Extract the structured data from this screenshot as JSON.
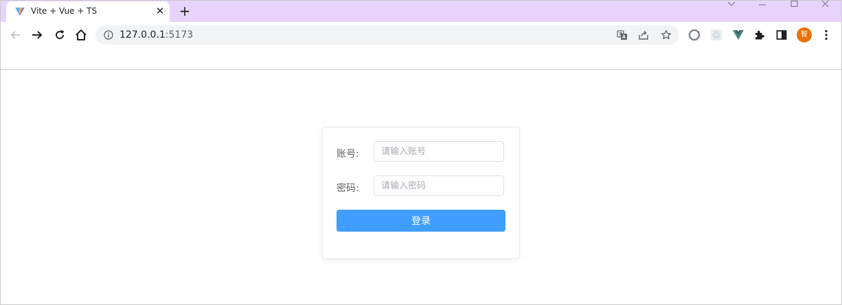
{
  "browser": {
    "tab": {
      "title": "Vite + Vue + TS",
      "favicon": "vite-icon"
    },
    "new_tab_label": "+",
    "close_label": "✕",
    "address": {
      "host": "127.0.0.1",
      "port": ":5173"
    },
    "profile_initial": "智",
    "colors": {
      "tabstrip": "#e8d3fd",
      "omnibox": "#f1f3f4",
      "avatar": "#e8710a"
    },
    "toolbar_icons": [
      "back-icon",
      "forward-icon",
      "reload-icon",
      "home-icon",
      "site-info-icon",
      "translate-icon",
      "share-icon",
      "bookmark-star-icon",
      "record-extension-icon",
      "react-devtools-icon",
      "vue-devtools-icon",
      "extensions-puzzle-icon",
      "side-panel-icon",
      "menu-kebab-icon"
    ]
  },
  "login_form": {
    "username_label": "账号:",
    "username_placeholder": "请输入账号",
    "username_value": "",
    "password_label": "密码:",
    "password_placeholder": "请输入密码",
    "password_value": "",
    "submit_label": "登录",
    "colors": {
      "primary": "#409eff",
      "label": "#606266",
      "border": "#dcdfe6"
    }
  }
}
